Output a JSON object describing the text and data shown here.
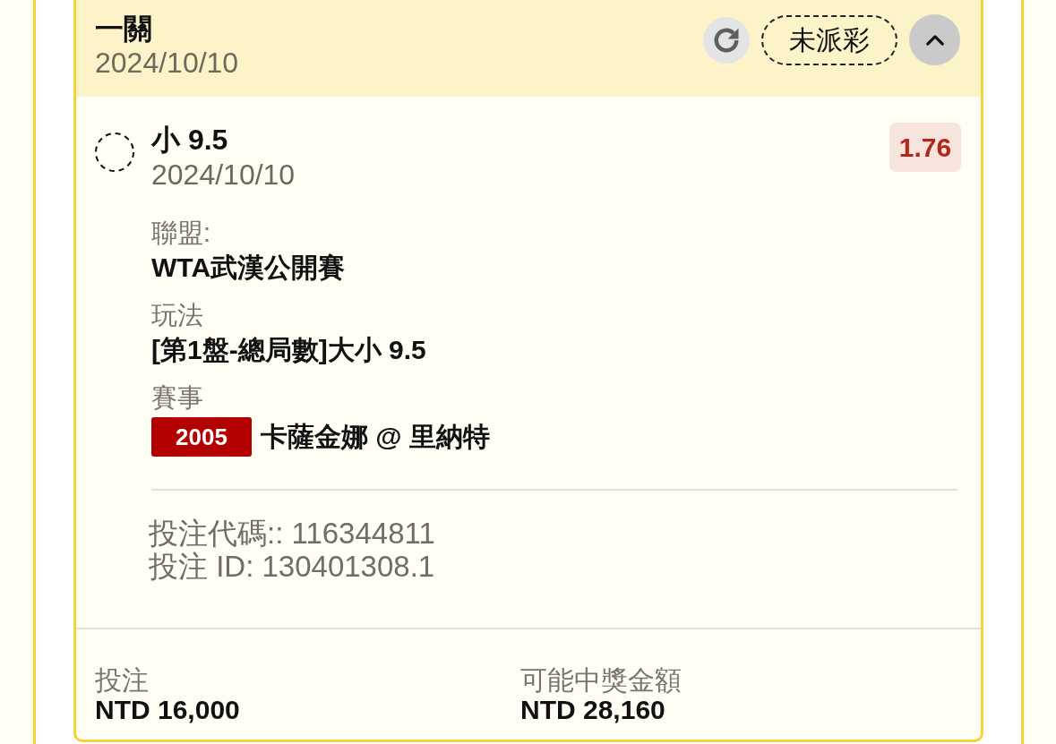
{
  "header": {
    "title": "一關",
    "date": "2024/10/10",
    "status": "未派彩",
    "expanded": true
  },
  "selection": {
    "name": "小 9.5",
    "date": "2024/10/10",
    "odds": "1.76",
    "details": [
      {
        "label": "聯盟:",
        "value": "WTA武漢公開賽"
      },
      {
        "label": "玩法",
        "value": "[第1盤-總局數]大小 9.5"
      },
      {
        "label": "賽事",
        "code": "2005",
        "value": "卡薩金娜 @ 里納特"
      }
    ],
    "bet_code": "投注代碼:: 116344811",
    "bet_id": "投注 ID: 130401308.1"
  },
  "summary": [
    {
      "label": "投注",
      "value": "NTD 16,000"
    },
    {
      "label": "可能中獎金額",
      "value": "NTD 28,160"
    }
  ]
}
